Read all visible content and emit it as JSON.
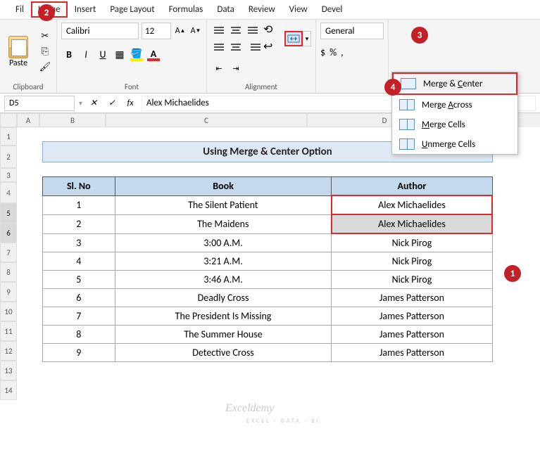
{
  "tabs": {
    "file": "Fil",
    "home": "Home",
    "insert": "Insert",
    "pagelayout": "Page Layout",
    "formulas": "Formulas",
    "data": "Data",
    "review": "Review",
    "view": "View",
    "developer": "Devel"
  },
  "clipboard": {
    "paste": "Paste",
    "group": "Clipboard"
  },
  "font": {
    "name": "Calibri",
    "size": "12",
    "group": "Font"
  },
  "alignment": {
    "group": "Alignment"
  },
  "number": {
    "format": "General",
    "currency": "$",
    "percent": "%",
    "comma": ","
  },
  "merge_menu": {
    "center": "Merge & ",
    "center_u": "C",
    "center_end": "enter",
    "across": "Merge ",
    "across_u": "A",
    "across_end": "cross",
    "cells": "",
    "cells_u": "M",
    "cells_end": "erge Cells",
    "unmerge": "",
    "unmerge_u": "U",
    "unmerge_end": "nmerge Cells"
  },
  "name_box": "D5",
  "formula_value": "Alex Michaelides",
  "title": "Using Merge & Center Option",
  "headers": {
    "slno": "Sl. No",
    "book": "Book",
    "author": "Author"
  },
  "rows": [
    {
      "sl": "1",
      "book": "The Silent Patient",
      "author": "Alex Michaelides"
    },
    {
      "sl": "2",
      "book": "The Maidens",
      "author": "Alex Michaelides"
    },
    {
      "sl": "3",
      "book": "3:00 A.M.",
      "author": "Nick Pirog"
    },
    {
      "sl": "4",
      "book": "3:21 A.M.",
      "author": "Nick Pirog"
    },
    {
      "sl": "5",
      "book": "3:46 A.M.",
      "author": "Nick Pirog"
    },
    {
      "sl": "6",
      "book": "Deadly Cross",
      "author": "James Patterson"
    },
    {
      "sl": "7",
      "book": "The President Is Missing",
      "author": "James Patterson"
    },
    {
      "sl": "8",
      "book": "The Summer House",
      "author": "James Patterson"
    },
    {
      "sl": "9",
      "book": "Detective Cross",
      "author": "James Patterson"
    }
  ],
  "cols": [
    "A",
    "B",
    "C",
    "D"
  ],
  "row_nums": [
    "1",
    "2",
    "3",
    "4",
    "5",
    "6",
    "7",
    "8",
    "9",
    "10",
    "11",
    "12",
    "13",
    "14"
  ],
  "badges": {
    "b1": "1",
    "b2": "2",
    "b3": "3",
    "b4": "4"
  },
  "watermark": "Exceldemy",
  "watermark_sub": "EXCEL · DATA · BI"
}
